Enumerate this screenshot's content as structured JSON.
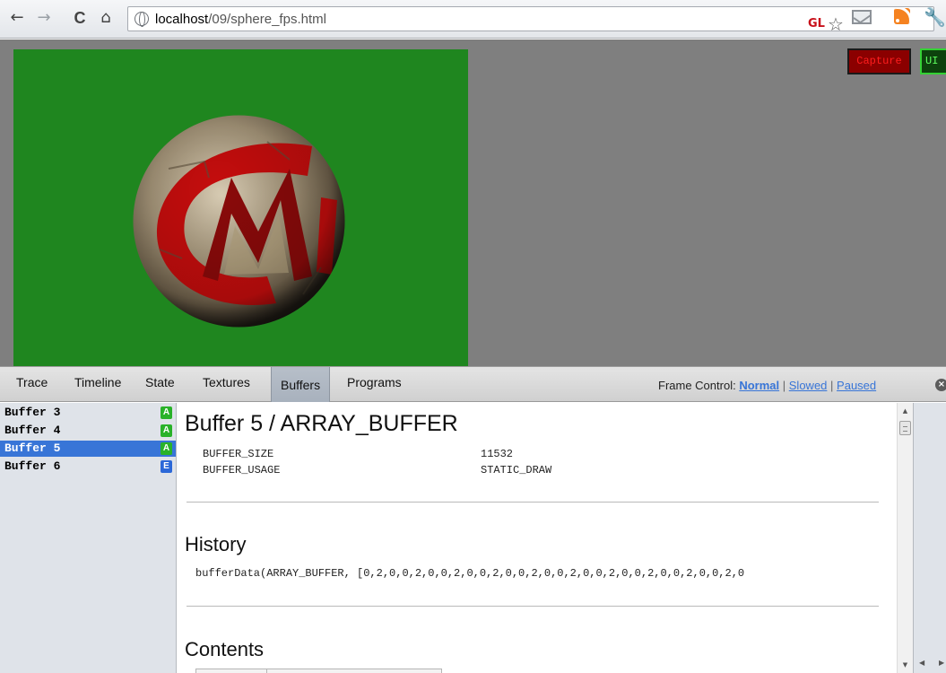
{
  "browser": {
    "nav": {
      "back": "←",
      "forward": "→",
      "reload": "C",
      "home": "⌂"
    },
    "url": {
      "host": "localhost",
      "path": "/09/sphere_fps.html"
    },
    "extension_badge": "GL",
    "star_glyph": "☆",
    "wrench_glyph": "🔧"
  },
  "canvas": {
    "background_color": "#1f861f",
    "capture_label": "Capture",
    "ui_label": "UI"
  },
  "tabs": [
    {
      "label": "Trace"
    },
    {
      "label": "Timeline"
    },
    {
      "label": "State"
    },
    {
      "label": "Textures"
    },
    {
      "label": "Buffers",
      "active": true
    },
    {
      "label": "Programs"
    }
  ],
  "frame_control": {
    "label": "Frame Control:",
    "options": [
      "Normal",
      "Slowed",
      "Paused"
    ],
    "active": "Normal",
    "separator": "|"
  },
  "buffers": [
    {
      "label": "Buffer 3",
      "badge": "A",
      "badge_color": "#29b229"
    },
    {
      "label": "Buffer 4",
      "badge": "A",
      "badge_color": "#29b229"
    },
    {
      "label": "Buffer 5",
      "badge": "A",
      "badge_color": "#29b229",
      "selected": true
    },
    {
      "label": "Buffer 6",
      "badge": "E",
      "badge_color": "#2b68d8"
    }
  ],
  "detail": {
    "title": "Buffer 5 / ARRAY_BUFFER",
    "properties": [
      {
        "name": "BUFFER_SIZE",
        "value": "11532"
      },
      {
        "name": "BUFFER_USAGE",
        "value": "STATIC_DRAW"
      }
    ],
    "history_title": "History",
    "history_call": "bufferData(ARRAY_BUFFER, [0,2,0,0,2,0,0,2,0,0,2,0,0,2,0,0,2,0,0,2,0,0,2,0,0,2,0,0,2,0",
    "contents_title": "Contents"
  },
  "colors": {
    "accent": "#3875d7",
    "canvas_bg": "#1f861f",
    "capture_bg": "#8b0000",
    "capture_text": "#ff1d1d",
    "ui_border": "#34d234"
  }
}
